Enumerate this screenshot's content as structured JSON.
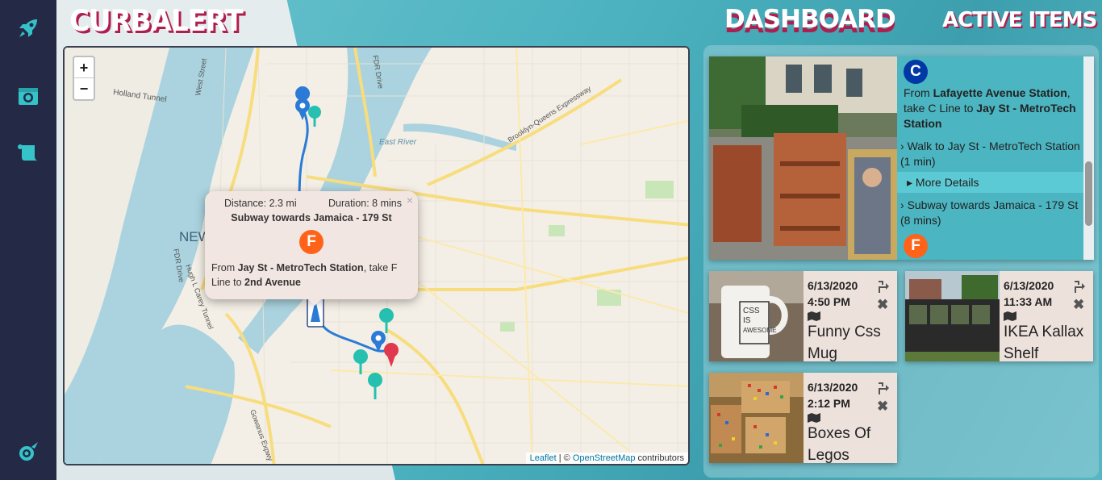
{
  "app": {
    "title": "CURBALERT"
  },
  "header": {
    "dashboard": "DASHBOARD",
    "active_items": "ACTIVE ITEMS"
  },
  "sidebar": {
    "items": [
      {
        "icon": "rocket-icon"
      },
      {
        "icon": "camera-icon"
      },
      {
        "icon": "scroll-icon"
      },
      {
        "icon": "comet-icon"
      }
    ]
  },
  "map": {
    "zoom_in": "+",
    "zoom_out": "−",
    "labels": {
      "city": "NEW YORK",
      "holland_tunnel": "Holland Tunnel",
      "west_street": "West Street",
      "fdr_drive": "FDR Drive",
      "east_river": "East River",
      "bqe": "Brooklyn-Queens Expressway",
      "fdr_drive_2": "FDR Drive",
      "carey_tunnel": "Hugh L Carey Tunnel",
      "gowanus": "Gowanus Expwy"
    },
    "attribution": {
      "leaflet": "Leaflet",
      "sep": " | © ",
      "osm": "OpenStreetMap",
      "suffix": " contributors"
    },
    "popup": {
      "distance": "Distance: 2.3 mi",
      "duration": "Duration: 8 mins",
      "subway": "Subway towards Jamaica - 179 St",
      "line": "F",
      "from_prefix": "From ",
      "from_station": "Jay St - MetroTech Station",
      "take": ", take F Line to ",
      "to_station": "2nd Avenue",
      "close": "×"
    }
  },
  "featured": {
    "line": "C",
    "from_prefix": "From ",
    "from_station": "Lafayette Avenue Station",
    "take": ", take C Line to ",
    "to_station": "Jay St - MetroTech Station",
    "step1": "Walk to Jay St - MetroTech Station (1 min)",
    "more": "More Details",
    "step2": "Subway towards Jamaica - 179 St (8 mins)",
    "line2": "F"
  },
  "cards": [
    {
      "date": "6/13/2020",
      "time": "4:50 PM",
      "name": "Funny Css Mug"
    },
    {
      "date": "6/13/2020",
      "time": "11:33 AM",
      "name": "IKEA Kallax Shelf"
    },
    {
      "date": "6/13/2020",
      "time": "2:12 PM",
      "name": "Boxes Of Legos"
    }
  ],
  "colors": {
    "sidebar": "#242a45",
    "accent": "#b01e4d",
    "teal": "#4bb5c1",
    "route": "#2b7bd6",
    "subway_f": "#ff6319",
    "subway_c": "#0039a6"
  }
}
